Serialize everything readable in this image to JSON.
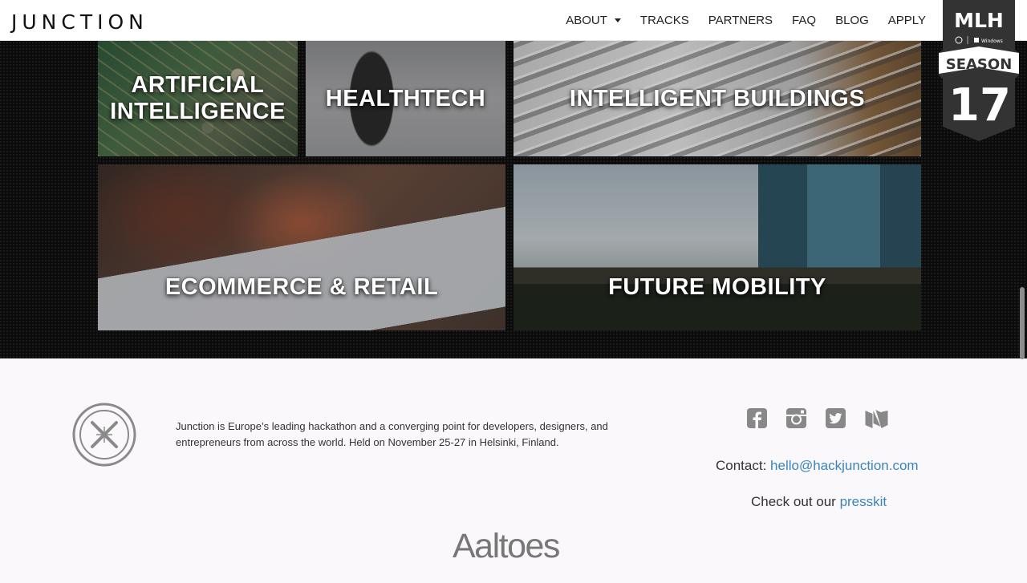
{
  "nav": {
    "logo": "JUNCTION",
    "items": [
      {
        "label": "ABOUT",
        "has_dropdown": true
      },
      {
        "label": "TRACKS"
      },
      {
        "label": "PARTNERS"
      },
      {
        "label": "FAQ"
      },
      {
        "label": "BLOG"
      },
      {
        "label": "APPLY"
      }
    ]
  },
  "badge": {
    "title": "MLH",
    "season_label": "SEASON",
    "season_number": "17",
    "sponsor": "Windows"
  },
  "tracks": [
    {
      "label": "ARTIFICIAL INTELLIGENCE",
      "line1": "ARTIFICIAL",
      "line2": "INTELLIGENCE"
    },
    {
      "label": "HEALTHTECH"
    },
    {
      "label": "INTELLIGENT BUILDINGS"
    },
    {
      "label": "ECOMMERCE & RETAIL"
    },
    {
      "label": "FUTURE MOBILITY"
    }
  ],
  "footer": {
    "description": "Junction is Europe’s leading hackathon and a converging point for developers, designers, and entrepreneurs from across the world. Held on November 25-27 in Helsinki, Finland.",
    "contact_prefix": "Contact: ",
    "contact_email": "hello@hackjunction.com",
    "presskit_prefix": "Check out our ",
    "presskit_link": "presskit",
    "sponsor_name": "Aaltoes",
    "socials": [
      "facebook-icon",
      "instagram-icon",
      "twitter-icon",
      "medium-icon"
    ]
  },
  "colors": {
    "link": "#3a84be",
    "nav_text": "#222222",
    "footer_bg": "#faf8fb",
    "icon_gray": "#888888"
  }
}
